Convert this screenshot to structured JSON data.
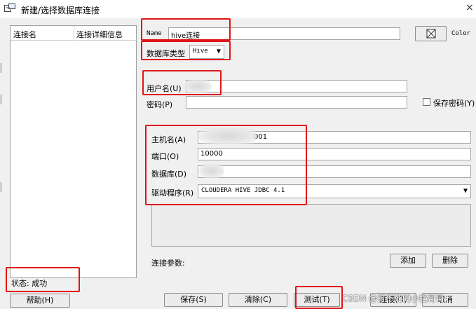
{
  "window": {
    "title": "新建/选择数据库连接",
    "close": "×"
  },
  "list": {
    "col1": "连接名",
    "col2": "连接详细信息"
  },
  "form": {
    "name_label": "Name",
    "name_value": "hive连接",
    "color_label": "Color",
    "dbtype_label": "数据库类型",
    "dbtype_value": "Hive",
    "user_label": "用户名(U)",
    "password_label": "密码(P)",
    "save_password_label": "保存密码(Y)",
    "host_label": "主机名(A)",
    "host_value": "001",
    "port_label": "端口(O)",
    "port_value": "10000",
    "database_label": "数据库(D)",
    "driver_label": "驱动程序(R)",
    "driver_value": "CLOUDERA HIVE JDBC 4.1",
    "params_label": "连接参数:",
    "add_label": "添加",
    "delete_label": "删除"
  },
  "status": {
    "label": "状态: 成功"
  },
  "buttons": {
    "help": "帮助(H)",
    "save": "保存(S)",
    "clear": "清除(C)",
    "test": "测试(T)",
    "connect": "连接(O)",
    "cancel": "取消"
  },
  "watermark": "CSDN @打不死的小强哥哥",
  "colors": {
    "highlight": "#e01515"
  }
}
